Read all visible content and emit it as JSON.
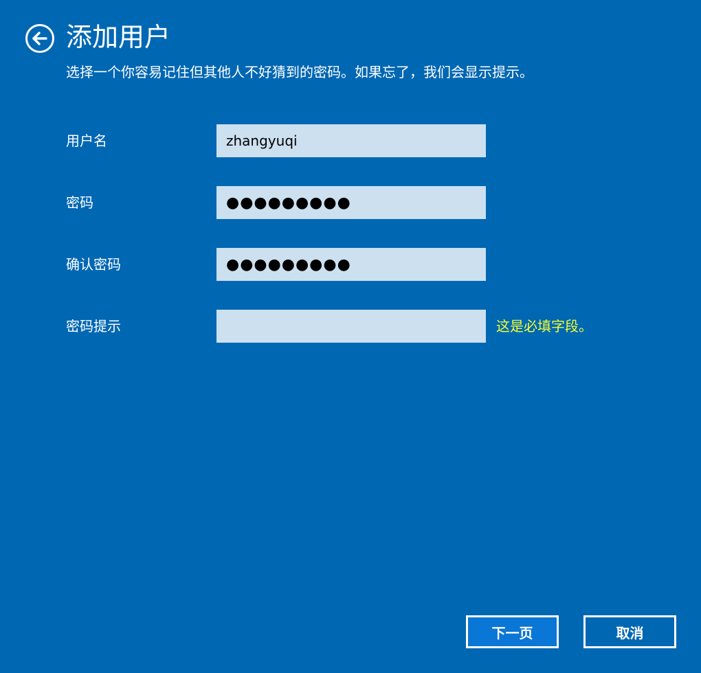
{
  "header": {
    "back_icon": "back-arrow-circle-icon",
    "title": "添加用户",
    "subtitle": "选择一个你容易记住但其他人不好猜到的密码。如果忘了，我们会显示提示。"
  },
  "form": {
    "username": {
      "label": "用户名",
      "value": "zhangyuqi"
    },
    "password": {
      "label": "密码",
      "value": "●●●●●●●●●"
    },
    "confirm_password": {
      "label": "确认密码",
      "value": "●●●●●●●●●"
    },
    "password_hint": {
      "label": "密码提示",
      "value": "",
      "error": "这是必填字段。"
    }
  },
  "buttons": {
    "next": "下一页",
    "cancel": "取消"
  },
  "colors": {
    "background": "#0067b3",
    "field_background": "#cce0ef",
    "error_text": "#f3ff33",
    "primary_button": "#0a76d6"
  }
}
